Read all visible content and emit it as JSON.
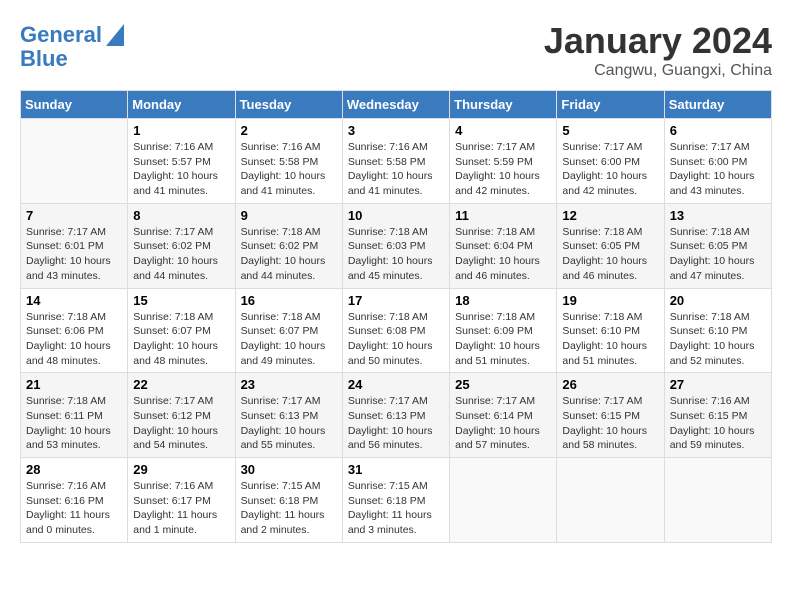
{
  "header": {
    "logo_line1": "General",
    "logo_line2": "Blue",
    "month": "January 2024",
    "location": "Cangwu, Guangxi, China"
  },
  "weekdays": [
    "Sunday",
    "Monday",
    "Tuesday",
    "Wednesday",
    "Thursday",
    "Friday",
    "Saturday"
  ],
  "weeks": [
    [
      {
        "day": "",
        "sunrise": "",
        "sunset": "",
        "daylight": ""
      },
      {
        "day": "1",
        "sunrise": "Sunrise: 7:16 AM",
        "sunset": "Sunset: 5:57 PM",
        "daylight": "Daylight: 10 hours and 41 minutes."
      },
      {
        "day": "2",
        "sunrise": "Sunrise: 7:16 AM",
        "sunset": "Sunset: 5:58 PM",
        "daylight": "Daylight: 10 hours and 41 minutes."
      },
      {
        "day": "3",
        "sunrise": "Sunrise: 7:16 AM",
        "sunset": "Sunset: 5:58 PM",
        "daylight": "Daylight: 10 hours and 41 minutes."
      },
      {
        "day": "4",
        "sunrise": "Sunrise: 7:17 AM",
        "sunset": "Sunset: 5:59 PM",
        "daylight": "Daylight: 10 hours and 42 minutes."
      },
      {
        "day": "5",
        "sunrise": "Sunrise: 7:17 AM",
        "sunset": "Sunset: 6:00 PM",
        "daylight": "Daylight: 10 hours and 42 minutes."
      },
      {
        "day": "6",
        "sunrise": "Sunrise: 7:17 AM",
        "sunset": "Sunset: 6:00 PM",
        "daylight": "Daylight: 10 hours and 43 minutes."
      }
    ],
    [
      {
        "day": "7",
        "sunrise": "Sunrise: 7:17 AM",
        "sunset": "Sunset: 6:01 PM",
        "daylight": "Daylight: 10 hours and 43 minutes."
      },
      {
        "day": "8",
        "sunrise": "Sunrise: 7:17 AM",
        "sunset": "Sunset: 6:02 PM",
        "daylight": "Daylight: 10 hours and 44 minutes."
      },
      {
        "day": "9",
        "sunrise": "Sunrise: 7:18 AM",
        "sunset": "Sunset: 6:02 PM",
        "daylight": "Daylight: 10 hours and 44 minutes."
      },
      {
        "day": "10",
        "sunrise": "Sunrise: 7:18 AM",
        "sunset": "Sunset: 6:03 PM",
        "daylight": "Daylight: 10 hours and 45 minutes."
      },
      {
        "day": "11",
        "sunrise": "Sunrise: 7:18 AM",
        "sunset": "Sunset: 6:04 PM",
        "daylight": "Daylight: 10 hours and 46 minutes."
      },
      {
        "day": "12",
        "sunrise": "Sunrise: 7:18 AM",
        "sunset": "Sunset: 6:05 PM",
        "daylight": "Daylight: 10 hours and 46 minutes."
      },
      {
        "day": "13",
        "sunrise": "Sunrise: 7:18 AM",
        "sunset": "Sunset: 6:05 PM",
        "daylight": "Daylight: 10 hours and 47 minutes."
      }
    ],
    [
      {
        "day": "14",
        "sunrise": "Sunrise: 7:18 AM",
        "sunset": "Sunset: 6:06 PM",
        "daylight": "Daylight: 10 hours and 48 minutes."
      },
      {
        "day": "15",
        "sunrise": "Sunrise: 7:18 AM",
        "sunset": "Sunset: 6:07 PM",
        "daylight": "Daylight: 10 hours and 48 minutes."
      },
      {
        "day": "16",
        "sunrise": "Sunrise: 7:18 AM",
        "sunset": "Sunset: 6:07 PM",
        "daylight": "Daylight: 10 hours and 49 minutes."
      },
      {
        "day": "17",
        "sunrise": "Sunrise: 7:18 AM",
        "sunset": "Sunset: 6:08 PM",
        "daylight": "Daylight: 10 hours and 50 minutes."
      },
      {
        "day": "18",
        "sunrise": "Sunrise: 7:18 AM",
        "sunset": "Sunset: 6:09 PM",
        "daylight": "Daylight: 10 hours and 51 minutes."
      },
      {
        "day": "19",
        "sunrise": "Sunrise: 7:18 AM",
        "sunset": "Sunset: 6:10 PM",
        "daylight": "Daylight: 10 hours and 51 minutes."
      },
      {
        "day": "20",
        "sunrise": "Sunrise: 7:18 AM",
        "sunset": "Sunset: 6:10 PM",
        "daylight": "Daylight: 10 hours and 52 minutes."
      }
    ],
    [
      {
        "day": "21",
        "sunrise": "Sunrise: 7:18 AM",
        "sunset": "Sunset: 6:11 PM",
        "daylight": "Daylight: 10 hours and 53 minutes."
      },
      {
        "day": "22",
        "sunrise": "Sunrise: 7:17 AM",
        "sunset": "Sunset: 6:12 PM",
        "daylight": "Daylight: 10 hours and 54 minutes."
      },
      {
        "day": "23",
        "sunrise": "Sunrise: 7:17 AM",
        "sunset": "Sunset: 6:13 PM",
        "daylight": "Daylight: 10 hours and 55 minutes."
      },
      {
        "day": "24",
        "sunrise": "Sunrise: 7:17 AM",
        "sunset": "Sunset: 6:13 PM",
        "daylight": "Daylight: 10 hours and 56 minutes."
      },
      {
        "day": "25",
        "sunrise": "Sunrise: 7:17 AM",
        "sunset": "Sunset: 6:14 PM",
        "daylight": "Daylight: 10 hours and 57 minutes."
      },
      {
        "day": "26",
        "sunrise": "Sunrise: 7:17 AM",
        "sunset": "Sunset: 6:15 PM",
        "daylight": "Daylight: 10 hours and 58 minutes."
      },
      {
        "day": "27",
        "sunrise": "Sunrise: 7:16 AM",
        "sunset": "Sunset: 6:15 PM",
        "daylight": "Daylight: 10 hours and 59 minutes."
      }
    ],
    [
      {
        "day": "28",
        "sunrise": "Sunrise: 7:16 AM",
        "sunset": "Sunset: 6:16 PM",
        "daylight": "Daylight: 11 hours and 0 minutes."
      },
      {
        "day": "29",
        "sunrise": "Sunrise: 7:16 AM",
        "sunset": "Sunset: 6:17 PM",
        "daylight": "Daylight: 11 hours and 1 minute."
      },
      {
        "day": "30",
        "sunrise": "Sunrise: 7:15 AM",
        "sunset": "Sunset: 6:18 PM",
        "daylight": "Daylight: 11 hours and 2 minutes."
      },
      {
        "day": "31",
        "sunrise": "Sunrise: 7:15 AM",
        "sunset": "Sunset: 6:18 PM",
        "daylight": "Daylight: 11 hours and 3 minutes."
      },
      {
        "day": "",
        "sunrise": "",
        "sunset": "",
        "daylight": ""
      },
      {
        "day": "",
        "sunrise": "",
        "sunset": "",
        "daylight": ""
      },
      {
        "day": "",
        "sunrise": "",
        "sunset": "",
        "daylight": ""
      }
    ]
  ]
}
